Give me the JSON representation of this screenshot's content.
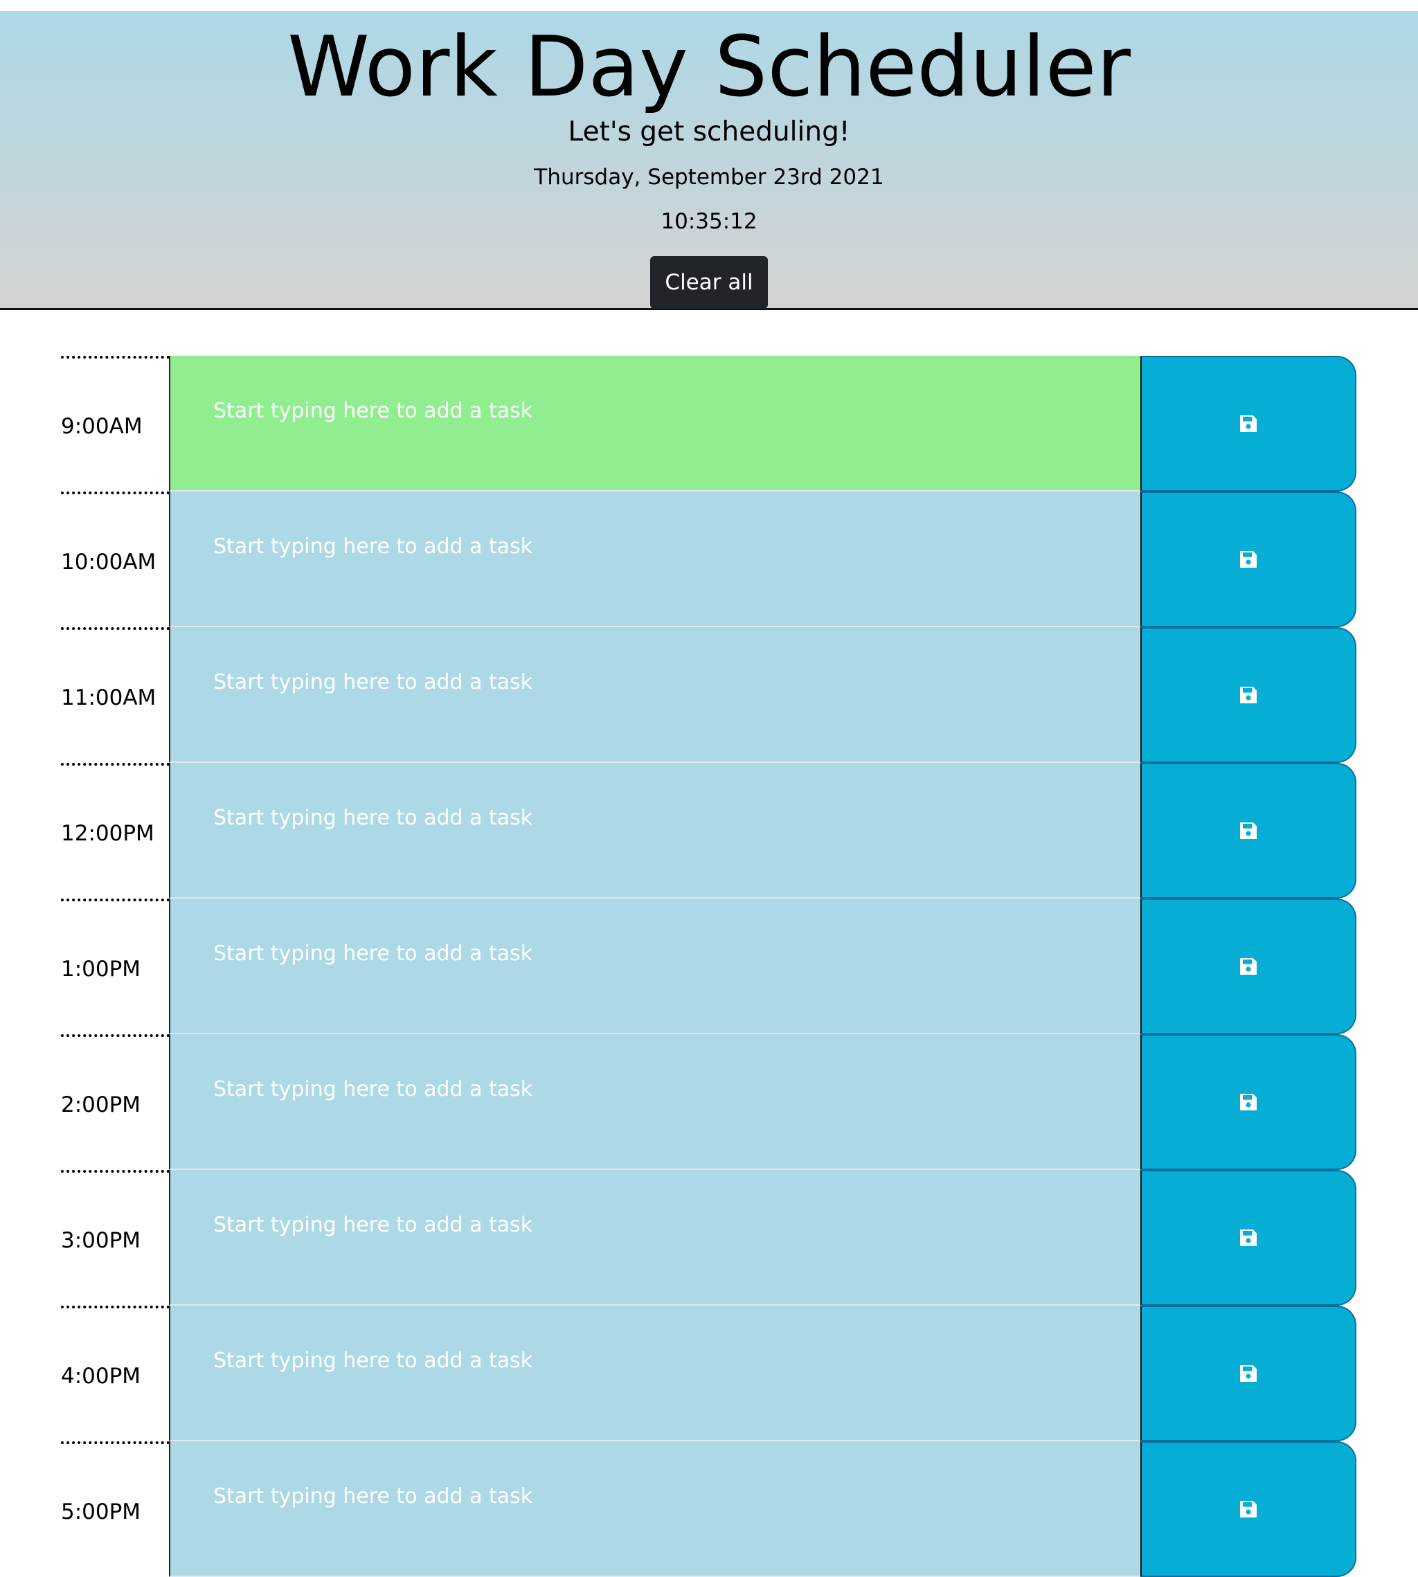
{
  "header": {
    "title": "Work Day Scheduler",
    "subtitle": "Let's get scheduling!",
    "date": "Thursday, September 23rd 2021",
    "time": "10:35:12",
    "clear_label": "Clear all"
  },
  "colors": {
    "present": "#90ee90",
    "future": "#add8e6",
    "save_button": "#06aed5",
    "clear_button": "#212529"
  },
  "icons": {
    "save": "floppy-disk"
  },
  "schedule": {
    "placeholder": "Start typing here to add a task",
    "blocks": [
      {
        "hour": "9:00AM",
        "status": "present",
        "task": ""
      },
      {
        "hour": "10:00AM",
        "status": "future",
        "task": ""
      },
      {
        "hour": "11:00AM",
        "status": "future",
        "task": ""
      },
      {
        "hour": "12:00PM",
        "status": "future",
        "task": ""
      },
      {
        "hour": "1:00PM",
        "status": "future",
        "task": ""
      },
      {
        "hour": "2:00PM",
        "status": "future",
        "task": ""
      },
      {
        "hour": "3:00PM",
        "status": "future",
        "task": ""
      },
      {
        "hour": "4:00PM",
        "status": "future",
        "task": ""
      },
      {
        "hour": "5:00PM",
        "status": "future",
        "task": ""
      }
    ]
  }
}
